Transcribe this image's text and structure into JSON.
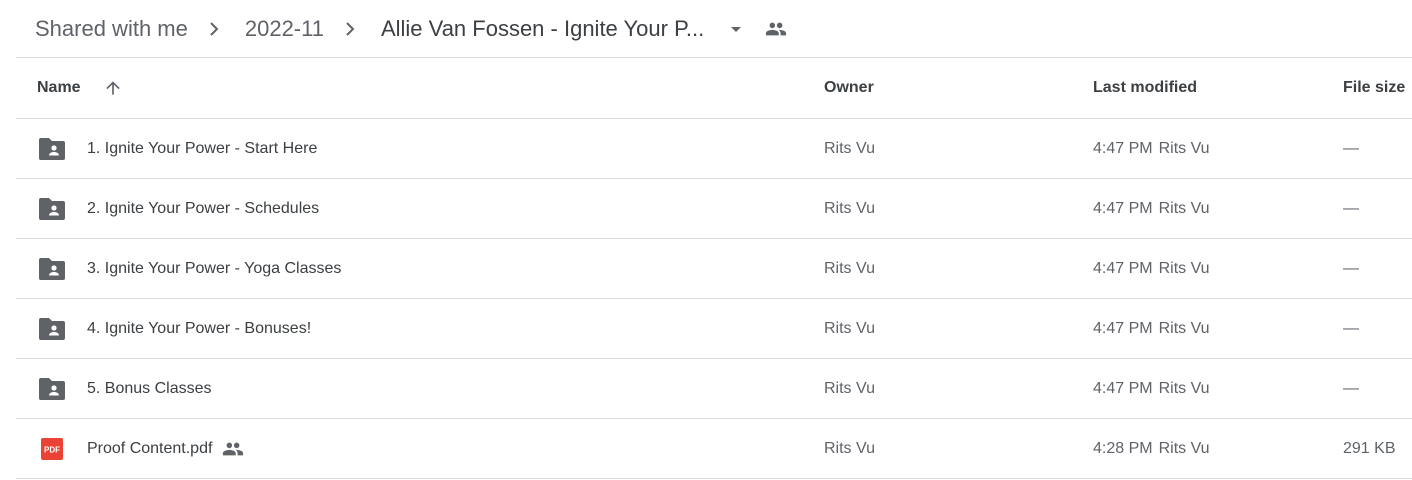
{
  "breadcrumb": {
    "items": [
      "Shared with me",
      "2022-11",
      "Allie Van Fossen - Ignite Your P..."
    ]
  },
  "table": {
    "headers": {
      "name": "Name",
      "owner": "Owner",
      "last_modified": "Last modified",
      "file_size": "File size"
    },
    "rows": [
      {
        "name": "1. Ignite Your Power - Start Here",
        "type": "shared-folder-icon",
        "owner": "Rits Vu",
        "modified_time": "4:47 PM",
        "modified_by": "Rits Vu",
        "size": "—"
      },
      {
        "name": "2. Ignite Your Power - Schedules",
        "type": "shared-folder-icon",
        "owner": "Rits Vu",
        "modified_time": "4:47 PM",
        "modified_by": "Rits Vu",
        "size": "—"
      },
      {
        "name": "3. Ignite Your Power - Yoga Classes",
        "type": "shared-folder-icon",
        "owner": "Rits Vu",
        "modified_time": "4:47 PM",
        "modified_by": "Rits Vu",
        "size": "—"
      },
      {
        "name": "4. Ignite Your Power - Bonuses!",
        "type": "shared-folder-icon",
        "owner": "Rits Vu",
        "modified_time": "4:47 PM",
        "modified_by": "Rits Vu",
        "size": "—"
      },
      {
        "name": "5. Bonus Classes",
        "type": "shared-folder-icon",
        "owner": "Rits Vu",
        "modified_time": "4:47 PM",
        "modified_by": "Rits Vu",
        "size": "—"
      },
      {
        "name": "Proof Content.pdf",
        "type": "pdf-icon",
        "pdf_label": "PDF",
        "owner": "Rits Vu",
        "modified_time": "4:28 PM",
        "modified_by": "Rits Vu",
        "size": "291 KB"
      }
    ]
  },
  "colors": {
    "folder": "#5f6368",
    "pdf": "#ea4335",
    "divider": "#dadce0"
  }
}
